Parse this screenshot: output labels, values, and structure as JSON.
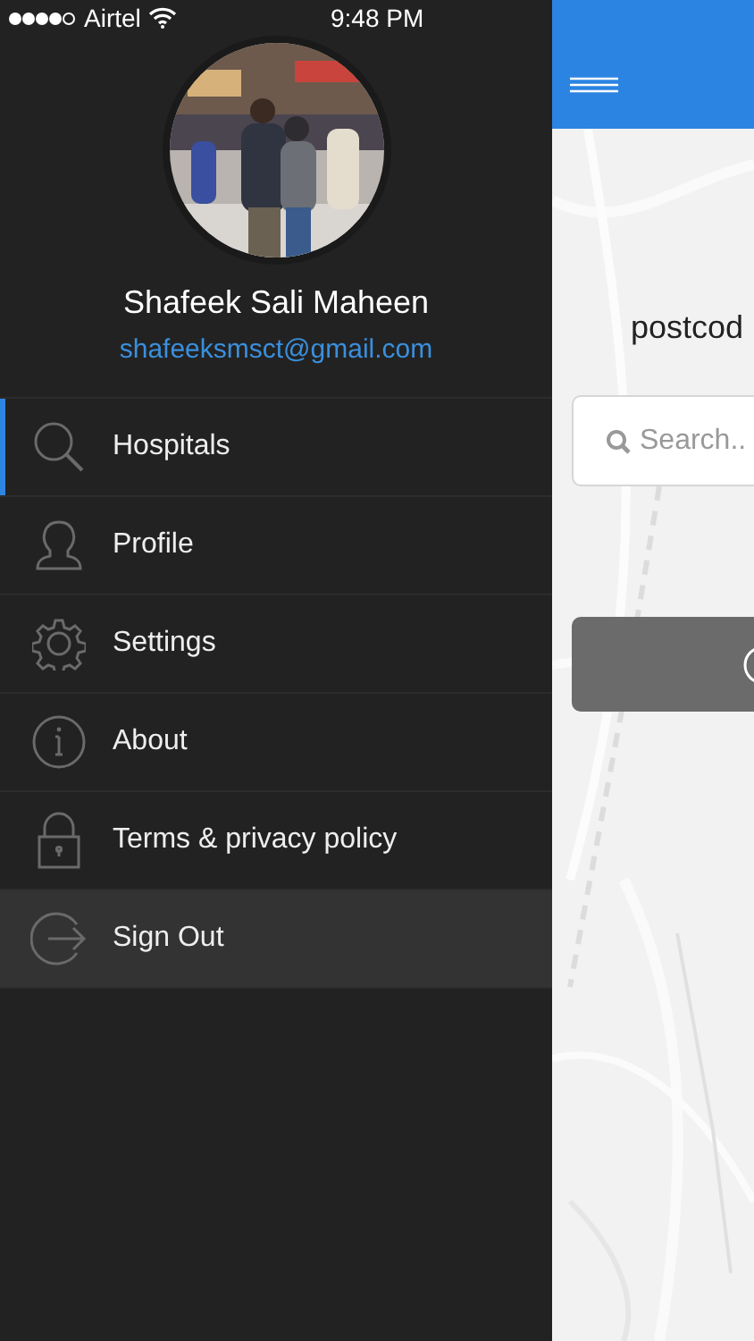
{
  "status_bar": {
    "carrier": "Airtel",
    "time": "9:48 PM"
  },
  "profile": {
    "name": "Shafeek Sali Maheen",
    "email": "shafeeksmsct@gmail.com"
  },
  "menu": [
    {
      "label": "Hospitals",
      "selected": true,
      "highlighted": false
    },
    {
      "label": "Profile",
      "selected": false,
      "highlighted": false
    },
    {
      "label": "Settings",
      "selected": false,
      "highlighted": false
    },
    {
      "label": "About",
      "selected": false,
      "highlighted": false
    },
    {
      "label": "Terms & privacy policy",
      "selected": false,
      "highlighted": false
    },
    {
      "label": "Sign Out",
      "selected": false,
      "highlighted": true
    }
  ],
  "main": {
    "label": "postcod",
    "search": {
      "placeholder": "Search.."
    }
  }
}
